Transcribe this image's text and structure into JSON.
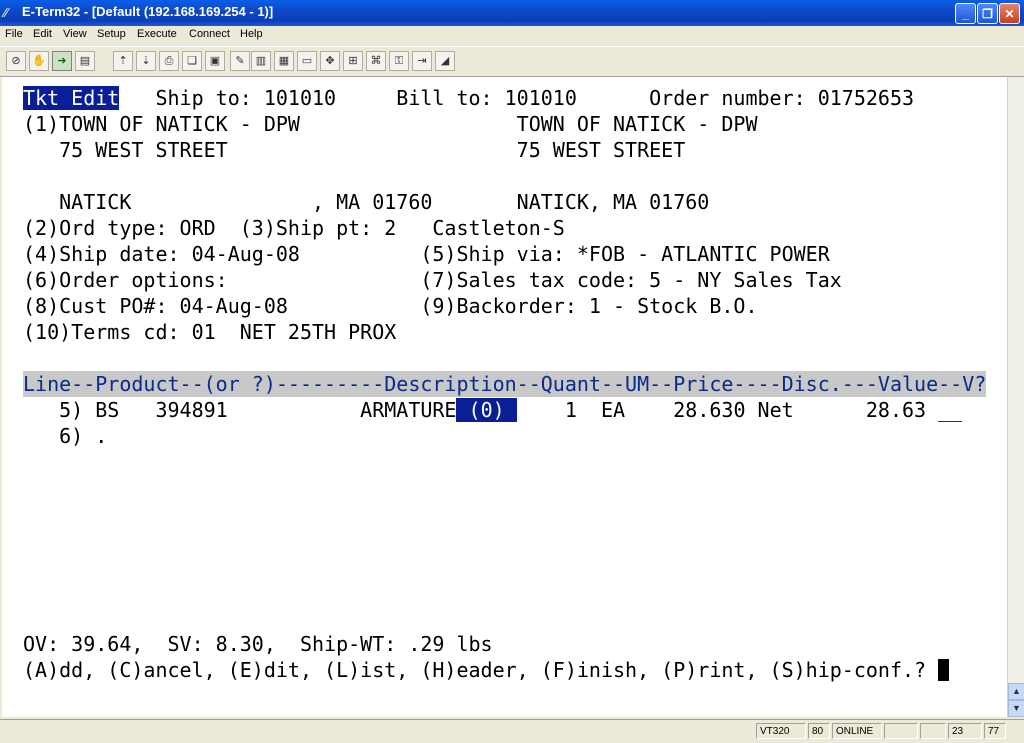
{
  "window": {
    "title": "E-Term32 - [Default (192.168.169.254 - 1)]",
    "minimize": "_",
    "restore": "❐",
    "close": "✕"
  },
  "menu": [
    "File",
    "Edit",
    "View",
    "Setup",
    "Execute",
    "Connect",
    "Help"
  ],
  "terminal": {
    "row1_label": "Tkt Edit",
    "row1_rest": "   Ship to: 101010     Bill to: 101010      Order number: 01752653",
    "row2": "(1)TOWN OF NATICK - DPW                  TOWN OF NATICK - DPW",
    "row3": "   75 WEST STREET                        75 WEST STREET",
    "row5": "   NATICK               , MA 01760       NATICK, MA 01760",
    "row6": "(2)Ord type: ORD  (3)Ship pt: 2   Castleton-S",
    "row7": "(4)Ship date: 04-Aug-08          (5)Ship via: *FOB - ATLANTIC POWER",
    "row8": "(6)Order options:                (7)Sales tax code: 5 - NY Sales Tax",
    "row9": "(8)Cust PO#: 04-Aug-08           (9)Backorder: 1 - Stock B.O.",
    "row10": "(10)Terms cd: 01  NET 25TH PROX",
    "column_header": "Line--Product--(or ?)---------Description--Quant--UM--Price----Disc.---Value--V?",
    "line5_pre": "   5) BS   394891           ARMATURE",
    "line5_highlight": " (0) ",
    "line5_post": "    1  EA    28.630 Net      28.63 __",
    "line6": "   6) .",
    "totals": "OV: 39.64,  SV: 8.30,  Ship-WT: .29 lbs",
    "prompt": "(A)dd, (C)ancel, (E)dit, (L)ist, (H)eader, (F)inish, (P)rint, (S)hip-conf.? "
  },
  "status": {
    "emulation": "VT320",
    "columns": "80",
    "connection": "ONLINE",
    "row": "23",
    "col": "77"
  }
}
